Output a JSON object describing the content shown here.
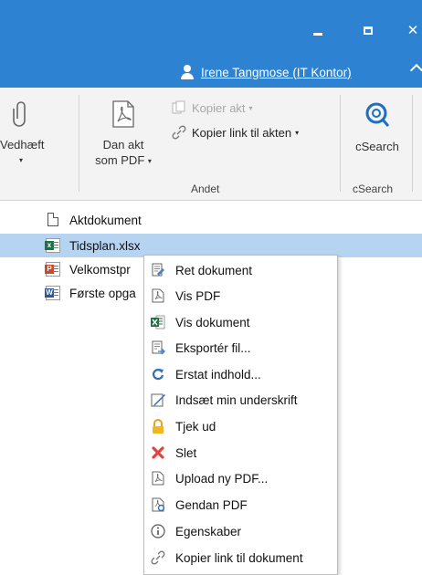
{
  "window": {
    "minimize_glyph": "minimize-icon",
    "maximize_glyph": "maximize-icon",
    "close_glyph": "✕",
    "user_name": "Irene Tangmose (IT Kontor)"
  },
  "ribbon": {
    "attach": {
      "line1": "Vedhæft",
      "caret": "▾",
      "icon": "paperclip-icon"
    },
    "pdf": {
      "line1": "Dan akt",
      "line2": "som PDF",
      "caret": "▾",
      "icon": "pdf-icon"
    },
    "copy_act": {
      "label": "Kopier akt",
      "caret": "▾",
      "icon": "copy-icon"
    },
    "copy_link": {
      "label": "Kopier link til akten",
      "caret": "▾",
      "icon": "link-icon"
    },
    "group_andet": "Andet",
    "csearch": {
      "label": "cSearch",
      "icon": "csearch-icon"
    },
    "group_csearch": "cSearch"
  },
  "documents": [
    {
      "name": "Aktdokument",
      "type": "generic"
    },
    {
      "name": "Tidsplan.xlsx",
      "type": "excel",
      "selected": true
    },
    {
      "name": "Velkomstpr",
      "type": "powerpoint"
    },
    {
      "name": "Første opga",
      "type": "word"
    }
  ],
  "context_menu": {
    "items": [
      {
        "label": "Ret dokument",
        "icon": "edit-document-icon"
      },
      {
        "label": "Vis PDF",
        "icon": "pdf-icon"
      },
      {
        "label": "Vis dokument",
        "icon": "excel-icon"
      },
      {
        "label": "Eksportér fil...",
        "icon": "export-icon"
      },
      {
        "label": "Erstat indhold...",
        "icon": "replace-icon"
      },
      {
        "label": "Indsæt min underskrift",
        "icon": "signature-icon"
      },
      {
        "label": "Tjek ud",
        "icon": "lock-icon"
      },
      {
        "label": "Slet",
        "icon": "delete-icon"
      },
      {
        "label": "Upload ny PDF...",
        "icon": "upload-pdf-icon"
      },
      {
        "label": "Gendan PDF",
        "icon": "restore-pdf-icon"
      },
      {
        "label": "Egenskaber",
        "icon": "info-icon"
      },
      {
        "label": "Kopier link til dokument",
        "icon": "link-icon"
      }
    ]
  },
  "colors": {
    "titlebar": "#2e82d2",
    "selection": "#b6d4f2",
    "ribbon_bg": "#f3f3f3"
  }
}
